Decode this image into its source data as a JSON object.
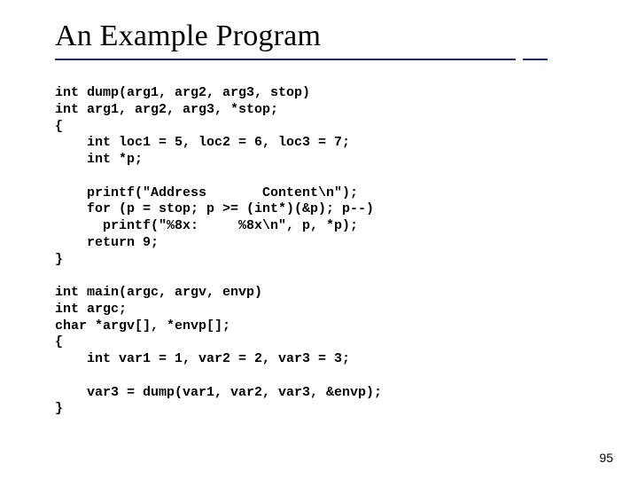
{
  "title": "An Example Program",
  "code_lines": [
    "int dump(arg1, arg2, arg3, stop)",
    "int arg1, arg2, arg3, *stop;",
    "{",
    "    int loc1 = 5, loc2 = 6, loc3 = 7;",
    "    int *p;",
    "",
    "    printf(\"Address       Content\\n\");",
    "    for (p = stop; p >= (int*)(&p); p--)",
    "      printf(\"%8x:     %8x\\n\", p, *p);",
    "    return 9;",
    "}",
    "",
    "int main(argc, argv, envp)",
    "int argc;",
    "char *argv[], *envp[];",
    "{",
    "    int var1 = 1, var2 = 2, var3 = 3;",
    "",
    "    var3 = dump(var1, var2, var3, &envp);",
    "}"
  ],
  "page_number": "95"
}
